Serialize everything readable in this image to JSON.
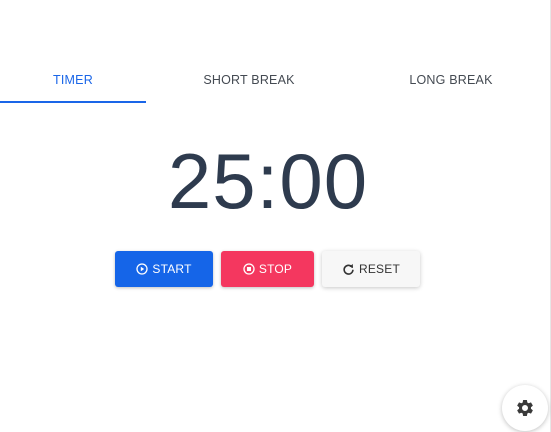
{
  "tabs": [
    {
      "label": "TIMER",
      "active": true
    },
    {
      "label": "SHORT BREAK",
      "active": false
    },
    {
      "label": "LONG BREAK",
      "active": false
    }
  ],
  "timer": {
    "display": "25:00"
  },
  "controls": {
    "start_label": "START",
    "start_icon": "play-circle-icon",
    "stop_label": "STOP",
    "stop_icon": "stop-circle-icon",
    "reset_label": "RESET",
    "reset_icon": "refresh-icon"
  },
  "settings": {
    "icon": "gear-icon"
  },
  "colors": {
    "accent": "#1a66e8",
    "start": "#1565e8",
    "stop": "#f4375f",
    "reset_bg": "#f7f7f7",
    "time_text": "#2e3b4e"
  }
}
